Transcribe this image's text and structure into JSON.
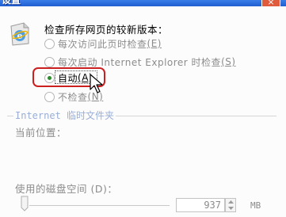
{
  "window": {
    "title": "设置",
    "close_label": "×"
  },
  "check_newer": {
    "heading": "检查所存网页的较新版本：",
    "options": [
      {
        "label": "每次访问此页时检查",
        "hotkey": "(E)",
        "selected": false
      },
      {
        "label": "每次启动 Internet Explorer 时检查",
        "hotkey": "(S)",
        "selected": false
      },
      {
        "label": "自动",
        "hotkey": "(A)",
        "selected": true
      },
      {
        "label": "不检查",
        "hotkey": "(N)",
        "selected": false
      }
    ]
  },
  "temp_files": {
    "group_label": "Internet 临时文件夹",
    "current_location_label": "当前位置：",
    "disk_space_label": "使用的磁盘空间 (D)：",
    "disk_space_value": "937",
    "disk_space_unit": "MB",
    "slider_fraction": 0.0
  },
  "colors": {
    "highlight_ring": "#cc1f1f",
    "title_bar": "#1f5fd0"
  },
  "icons": {
    "settings_icon": "ie-document-icon",
    "cursor": "mouse-pointer-icon"
  }
}
